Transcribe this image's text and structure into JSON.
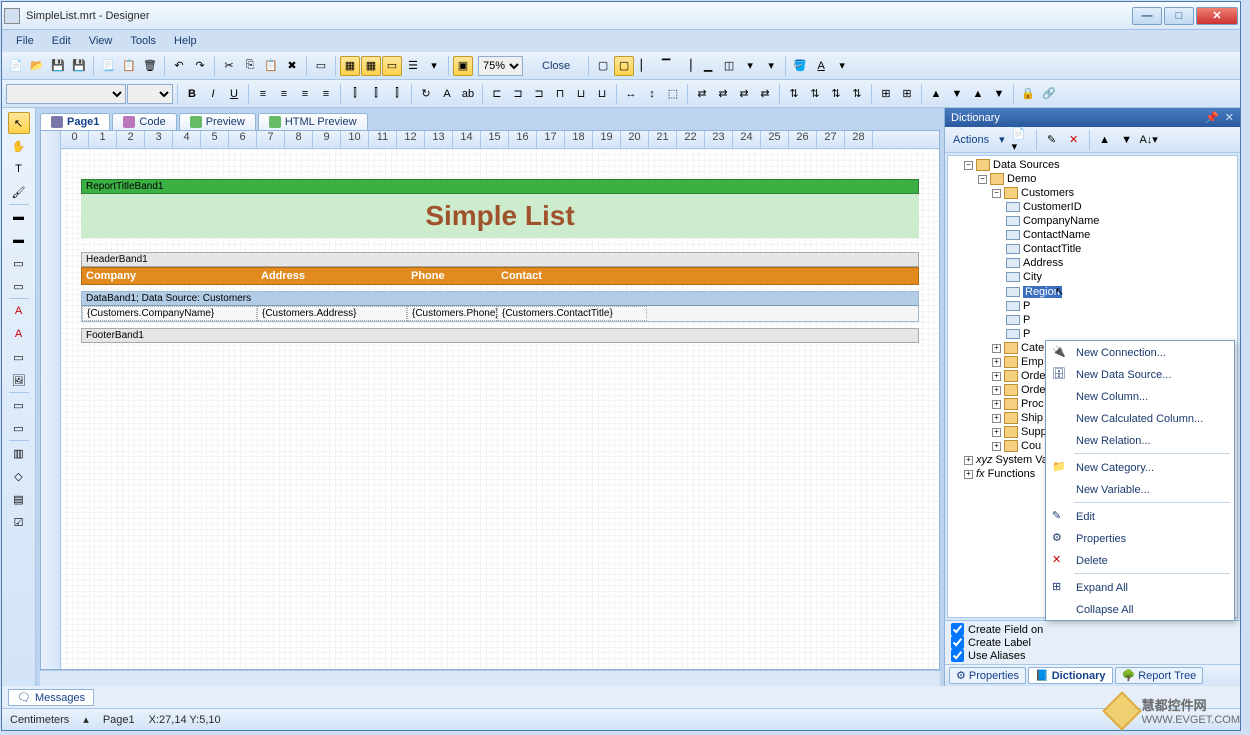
{
  "window": {
    "title": "SimpleList.mrt - Designer"
  },
  "menu": {
    "file": "File",
    "edit": "Edit",
    "view": "View",
    "tools": "Tools",
    "help": "Help"
  },
  "toolbar": {
    "zoom": "75%",
    "close": "Close"
  },
  "tabs": {
    "page1": "Page1",
    "code": "Code",
    "preview": "Preview",
    "html_preview": "HTML Preview"
  },
  "report": {
    "title_band": "ReportTitleBand1",
    "title_text": "Simple List",
    "header_band": "HeaderBand1",
    "columns": {
      "company": "Company",
      "address": "Address",
      "phone": "Phone",
      "contact": "Contact"
    },
    "data_band": "DataBand1; Data Source: Customers",
    "fields": {
      "company": "{Customers.CompanyName}",
      "address": "{Customers.Address}",
      "phone": "{Customers.Phone}",
      "contact": "{Customers.ContactTitle}"
    },
    "footer_band": "FooterBand1"
  },
  "dictionary": {
    "title": "Dictionary",
    "actions": "Actions",
    "root": "Data Sources",
    "demo": "Demo",
    "customers": "Customers",
    "fields": [
      "CustomerID",
      "CompanyName",
      "ContactName",
      "ContactTitle",
      "Address",
      "City",
      "Region",
      "P",
      "P",
      "P"
    ],
    "other_tables": [
      "Cate",
      "Emp",
      "Orde",
      "Orde",
      "Proc",
      "Ship",
      "Supp",
      "Cou"
    ],
    "system": "System Vari",
    "functions": "Functions",
    "checks": {
      "field": "Create Field on",
      "label": "Create Label",
      "alias": "Use Aliases"
    }
  },
  "bottom_tabs": {
    "properties": "Properties",
    "dictionary": "Dictionary",
    "report_tree": "Report Tree"
  },
  "messages": "Messages",
  "status": {
    "units": "Centimeters",
    "page": "Page1",
    "coords": "X:27,14 Y:5,10"
  },
  "ctx": {
    "new_connection": "New Connection...",
    "new_data_source": "New Data Source...",
    "new_column": "New Column...",
    "new_calc_column": "New Calculated Column...",
    "new_relation": "New Relation...",
    "new_category": "New Category...",
    "new_variable": "New Variable...",
    "edit": "Edit",
    "properties": "Properties",
    "delete": "Delete",
    "expand_all": "Expand All",
    "collapse_all": "Collapse All"
  },
  "watermark": {
    "cn": "慧都控件网",
    "en": "WWW.EVGET.COM"
  }
}
